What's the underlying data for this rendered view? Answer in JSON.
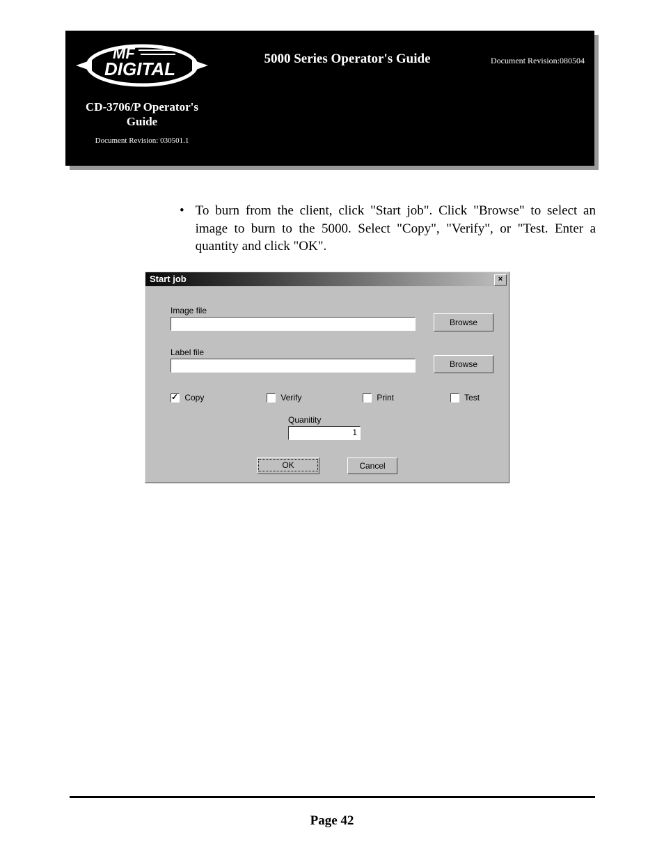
{
  "banner": {
    "left_title_line1": "CD-3706/P Operator's",
    "left_title_line2": "Guide",
    "left_revision": "Document Revision: 030501.1",
    "center_title": "5000 Series Operator's Guide",
    "right_revision": "Document Revision:080504",
    "logo_top": "MF",
    "logo_bottom": "DIGITAL"
  },
  "paragraph": "To burn from the client, click \"Start job\". Click \"Browse\" to select an image to burn to the 5000. Select \"Copy\", \"Verify\", or \"Test. Enter a quantity and click \"OK\".",
  "dialog": {
    "title": "Start job",
    "close": "×",
    "image_file_label": "Image file",
    "label_file_label": "Label file",
    "browse_label": "Browse",
    "copy_label": "Copy",
    "verify_label": "Verify",
    "print_label": "Print",
    "test_label": "Test",
    "quantity_label": "Quanitity",
    "quantity_value": "1",
    "ok_label": "OK",
    "cancel_label": "Cancel",
    "image_file_value": "",
    "label_file_value": "",
    "copy_checked": true,
    "verify_checked": false,
    "print_checked": false,
    "test_checked": false
  },
  "footer": {
    "page": "Page 42"
  }
}
